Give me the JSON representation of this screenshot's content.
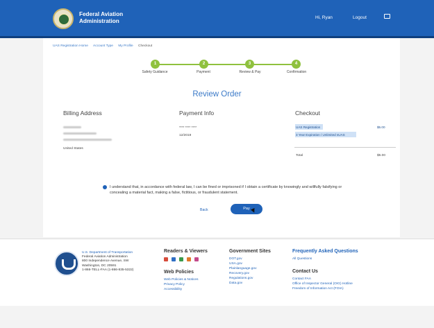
{
  "header": {
    "brand": "Federal Aviation Administration",
    "user": "Hi, Ryan",
    "logout": "Logout"
  },
  "breadcrumbs": [
    "UAS Registration Home",
    "Account Type",
    "My Profile",
    "Checkout"
  ],
  "steps": [
    {
      "number": "1",
      "label": "Safety Guidance"
    },
    {
      "number": "2",
      "label": "Payment"
    },
    {
      "number": "3",
      "label": "Review & Pay"
    },
    {
      "number": "4",
      "label": "Confirmation"
    }
  ],
  "review": {
    "title": "Review Order",
    "billing_heading": "Billing Address",
    "billing_country": "United States",
    "payment_heading": "Payment Info",
    "card_mask": "**** **** ****",
    "card_exp": "12/2019",
    "checkout_heading": "Checkout",
    "item_name": "UAS Registration",
    "item_price": "$5.00",
    "item_detail": "3 Year Expiration / Unlimited sUAS",
    "total_label": "Total",
    "total_value": "$5.00"
  },
  "consent": {
    "text": "I understand that, in accordance with federal law, I can be fined or imprisoned if I obtain a certificate by knowingly and willfully falsifying or concealing a material fact, making a false, fictitious, or fraudulent statement."
  },
  "actions": {
    "back": "Back",
    "pay": "Pay"
  },
  "footer": {
    "address": [
      "U.S. Department of Transportation",
      "Federal Aviation Administration",
      "800 Independence Avenue, SW",
      "Washington, DC 20591",
      "1-866-TELL-FAA (1-866-835-5322)"
    ],
    "readers_heading": "Readers & Viewers",
    "policies_heading": "Web Policies",
    "policies": [
      "Web Policies & Notices",
      "Privacy Policy",
      "Accessibility"
    ],
    "gov_heading": "Government Sites",
    "gov_sites": [
      "DOT.gov",
      "USA.gov",
      "Plainlanguage.gov",
      "Recovery.gov",
      "Regulations.gov",
      "Data.gov"
    ],
    "faq_heading": "Frequently Asked Questions",
    "faq_link": "All Questions",
    "contact_heading": "Contact Us",
    "contact_links": [
      "Contact FAA",
      "Office of Inspector General (OIG) Hotline",
      "Freedom of Information Act (FOIA)"
    ]
  },
  "colors": {
    "header_blue": "#1f62b8",
    "step_green": "#8fc13e"
  }
}
